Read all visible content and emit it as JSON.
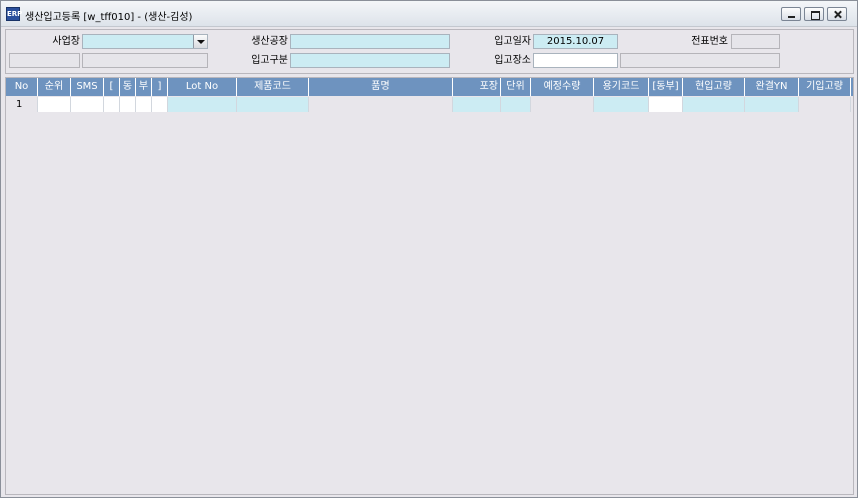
{
  "window": {
    "title": "생산입고등록 [w_tff010] - (생산-김성)",
    "icon_name": "app-icon",
    "icon_glyph": "ERP"
  },
  "form": {
    "business_site": {
      "label": "사업장",
      "value": ""
    },
    "business_site_code": "",
    "business_site_name": "",
    "production_plant": {
      "label": "생산공장",
      "value": ""
    },
    "receipt_type": {
      "label": "입고구분",
      "value": ""
    },
    "receipt_date": {
      "label": "입고일자",
      "value": "2015.10.07"
    },
    "receipt_location": {
      "label": "입고장소",
      "value": "",
      "desc": ""
    },
    "slip_no": {
      "label": "전표번호",
      "value": ""
    }
  },
  "grid": {
    "columns": [
      "No",
      "순위",
      "SMS",
      "[",
      "동",
      "부",
      "]",
      "Lot No",
      "제품코드",
      "품명",
      "포장",
      "단위",
      "예정수량",
      "용기코드",
      "[동부]",
      "현입고량",
      "완결YN",
      "기입고량"
    ],
    "rows": [
      {
        "no": "1",
        "cells": [
          "",
          "",
          "",
          "",
          "",
          "",
          "",
          "",
          "",
          "",
          "",
          "",
          "",
          "",
          "",
          "",
          ""
        ]
      }
    ]
  },
  "colors": {
    "header_bg": "#6e93bf",
    "field_cyan": "#ccecf3",
    "window_bg": "#e8e6eb"
  }
}
